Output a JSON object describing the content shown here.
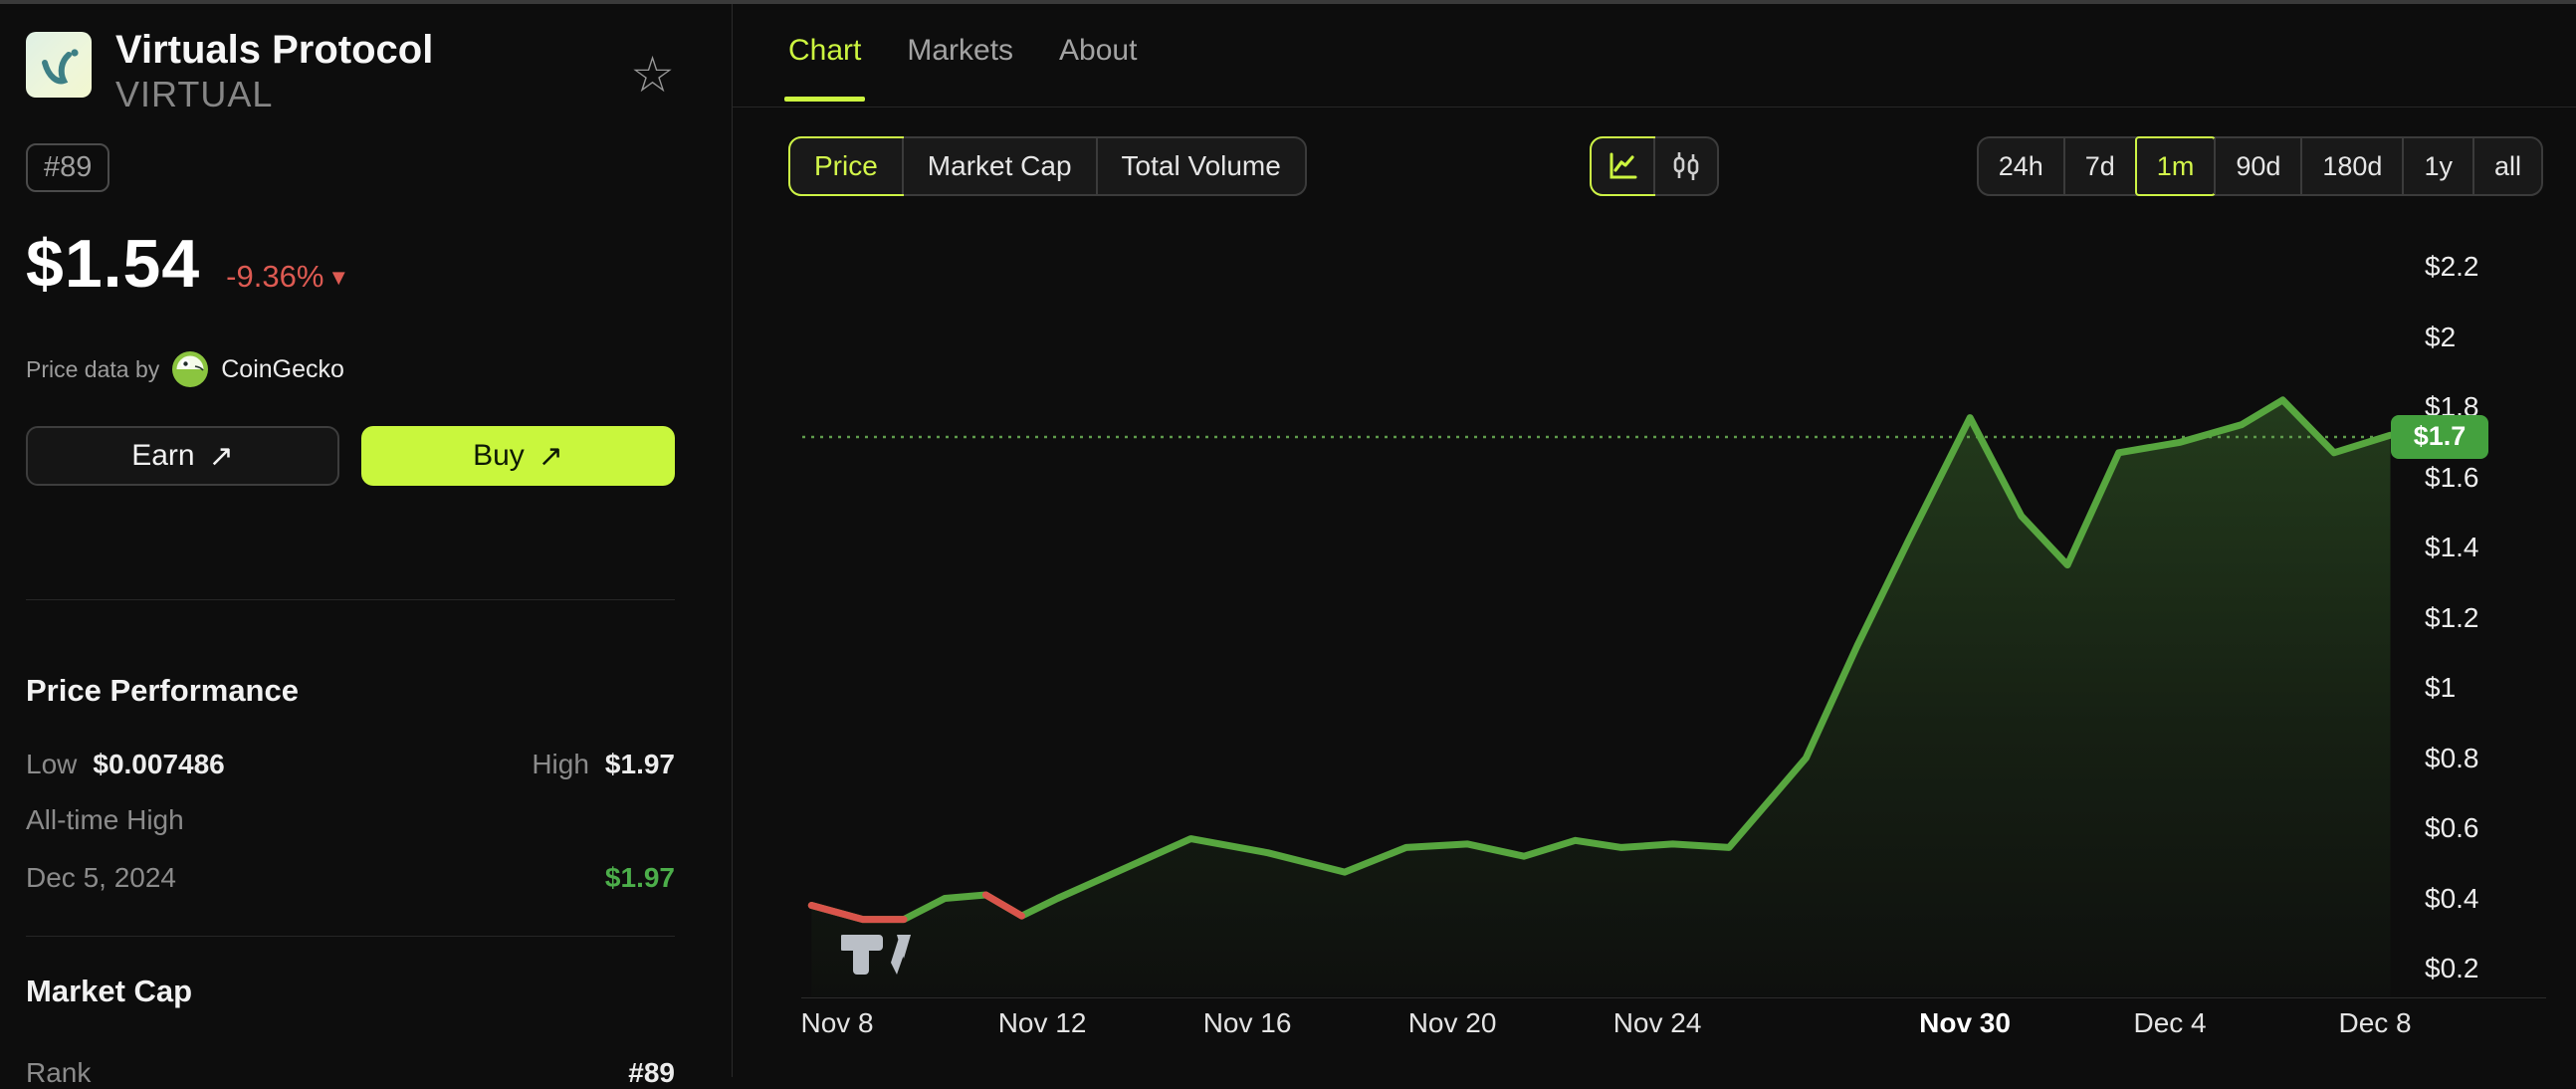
{
  "sidebar": {
    "coin": {
      "name": "Virtuals Protocol",
      "ticker": "VIRTUAL",
      "rank_badge": "#89"
    },
    "price": {
      "value": "$1.54",
      "change": "-9.36%",
      "change_dir": "▼"
    },
    "attribution": {
      "prefix": "Price data by",
      "provider": "CoinGecko"
    },
    "actions": {
      "earn_label": "Earn",
      "buy_label": "Buy",
      "arrow": "↗"
    },
    "price_performance": {
      "title": "Price Performance",
      "low_label": "Low",
      "low_value": "$0.007486",
      "high_label": "High",
      "high_value": "$1.97",
      "ath_label": "All-time High",
      "ath_date": "Dec 5, 2024",
      "ath_value": "$1.97"
    },
    "market_cap": {
      "title": "Market Cap",
      "rank_label": "Rank",
      "rank_value": "#89"
    }
  },
  "main": {
    "tabs": [
      {
        "label": "Chart",
        "active": true
      },
      {
        "label": "Markets",
        "active": false
      },
      {
        "label": "About",
        "active": false
      }
    ],
    "metric_toggle": [
      {
        "label": "Price",
        "active": true
      },
      {
        "label": "Market Cap",
        "active": false
      },
      {
        "label": "Total Volume",
        "active": false
      }
    ],
    "chart_types": [
      {
        "name": "line-chart",
        "active": true
      },
      {
        "name": "candlestick-chart",
        "active": false
      }
    ],
    "ranges": [
      {
        "label": "24h",
        "active": false
      },
      {
        "label": "7d",
        "active": false
      },
      {
        "label": "1m",
        "active": true
      },
      {
        "label": "90d",
        "active": false
      },
      {
        "label": "180d",
        "active": false
      },
      {
        "label": "1y",
        "active": false
      },
      {
        "label": "all",
        "active": false
      }
    ]
  },
  "chart_data": {
    "type": "area",
    "x_axis": "dates Nov 8 - Dec 8 (days numbered from Nov 1 = 1, Dec 1 = 31)",
    "price_axis": {
      "min": 0.2,
      "max": 2.2,
      "tick_step": 0.2,
      "unit": "$"
    },
    "current_price": 1.715,
    "current_price_label": "$1.7",
    "grid": false,
    "legend": false,
    "y_ticks": [
      {
        "label": "$2.2",
        "value": 2.2
      },
      {
        "label": "$2",
        "value": 2.0
      },
      {
        "label": "$1.8",
        "value": 1.8
      },
      {
        "label": "$1.6",
        "value": 1.6
      },
      {
        "label": "$1.4",
        "value": 1.4
      },
      {
        "label": "$1.2",
        "value": 1.2
      },
      {
        "label": "$1",
        "value": 1.0
      },
      {
        "label": "$0.8",
        "value": 0.8
      },
      {
        "label": "$0.6",
        "value": 0.6
      },
      {
        "label": "$0.4",
        "value": 0.4
      },
      {
        "label": "$0.2",
        "value": 0.2
      }
    ],
    "x_ticks": [
      {
        "label": "Nov 8",
        "day": 8,
        "bold": false
      },
      {
        "label": "Nov 12",
        "day": 12,
        "bold": false
      },
      {
        "label": "Nov 16",
        "day": 16,
        "bold": false
      },
      {
        "label": "Nov 20",
        "day": 20,
        "bold": false
      },
      {
        "label": "Nov 24",
        "day": 24,
        "bold": false
      },
      {
        "label": "Nov 30",
        "day": 30,
        "bold": true
      },
      {
        "label": "Dec 4",
        "day": 34,
        "bold": false
      },
      {
        "label": "Dec 8",
        "day": 38,
        "bold": false
      }
    ],
    "points": [
      [
        7.5,
        0.38
      ],
      [
        8.5,
        0.34
      ],
      [
        9.3,
        0.34
      ],
      [
        10.1,
        0.4
      ],
      [
        10.9,
        0.41
      ],
      [
        11.6,
        0.35
      ],
      [
        12.3,
        0.4
      ],
      [
        14.9,
        0.57
      ],
      [
        16.4,
        0.53
      ],
      [
        17.9,
        0.475
      ],
      [
        19.1,
        0.545
      ],
      [
        20.3,
        0.555
      ],
      [
        21.4,
        0.52
      ],
      [
        22.4,
        0.565
      ],
      [
        23.3,
        0.545
      ],
      [
        24.3,
        0.555
      ],
      [
        25.4,
        0.545
      ],
      [
        26.9,
        0.8
      ],
      [
        27.9,
        1.12
      ],
      [
        28.9,
        1.42
      ],
      [
        30.1,
        1.77
      ],
      [
        31.1,
        1.49
      ],
      [
        32.0,
        1.35
      ],
      [
        33.0,
        1.67
      ],
      [
        34.2,
        1.7
      ],
      [
        35.4,
        1.75
      ],
      [
        36.2,
        1.82
      ],
      [
        37.2,
        1.67
      ],
      [
        38.3,
        1.72
      ]
    ],
    "red_segments": [
      [
        0,
        2
      ],
      [
        4,
        5
      ]
    ]
  },
  "colors": {
    "accent_lime": "#ccf53f",
    "buy_bg": "#c9f73d",
    "line_green": "#57a63f",
    "line_red": "#d9544b",
    "badge_green": "#44a13e",
    "change_red": "#dd5a52",
    "ath_green": "#4cae4a"
  }
}
